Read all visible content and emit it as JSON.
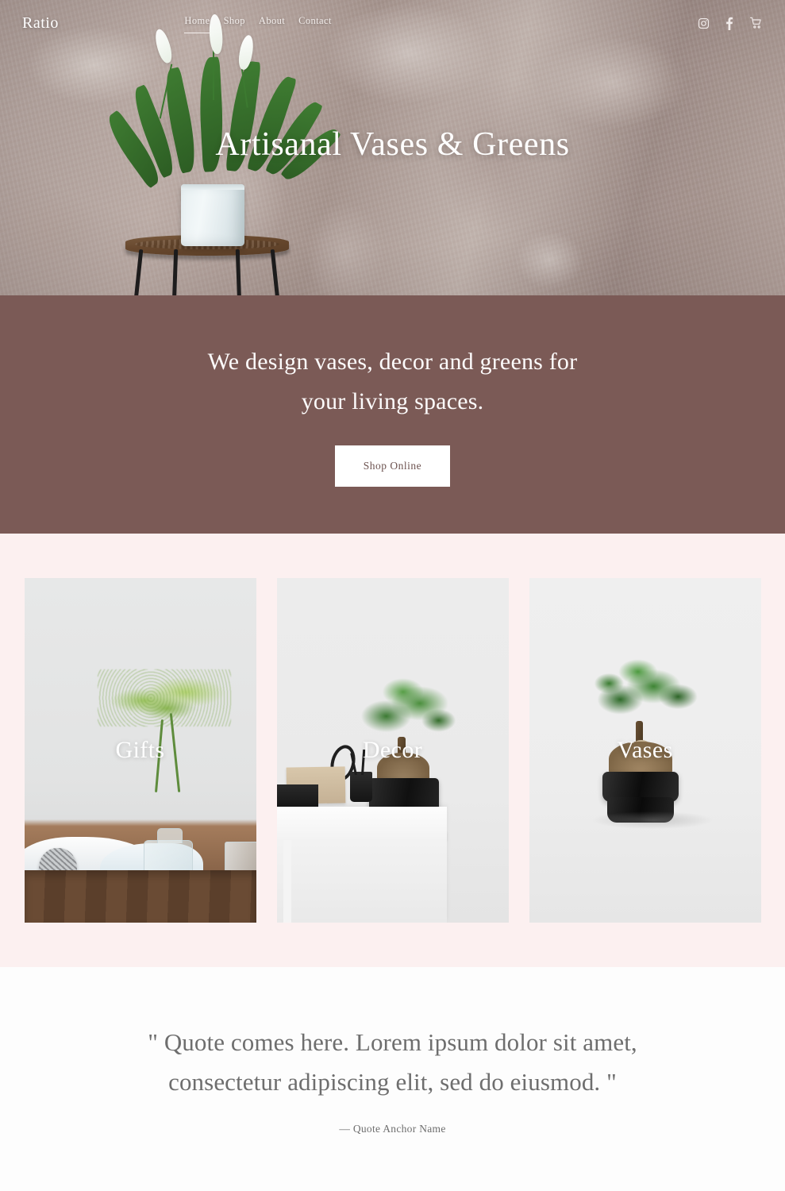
{
  "header": {
    "logo": "Ratio",
    "nav": [
      {
        "label": "Home",
        "active": true
      },
      {
        "label": "Shop",
        "active": false
      },
      {
        "label": "About",
        "active": false
      },
      {
        "label": "Contact",
        "active": false
      }
    ],
    "icons": [
      "instagram-icon",
      "facebook-icon",
      "cart-icon"
    ]
  },
  "hero": {
    "title": "Artisanal Vases & Greens",
    "image_description": "Peace lily plant in a white pot on a wooden stool against a weathered plaster wall"
  },
  "tagline": {
    "line1": "We design vases, decor and greens for",
    "line2": "your living spaces.",
    "button": "Shop Online"
  },
  "categories": [
    {
      "label": "Gifts",
      "image_description": "Green flowers in a glass jar with books, twine and burlap on a wooden table"
    },
    {
      "label": "Decor",
      "image_description": "Bonsai in a black planter on a white desk with stationery"
    },
    {
      "label": "Vases",
      "image_description": "Bonsai tree in a glossy black ceramic pot on a white surface"
    }
  ],
  "quote": {
    "line1": "\" Quote comes here. Lorem ipsum dolor sit amet,",
    "line2": "consectetur adipiscing elit, sed do eiusmod. \"",
    "anchor": "— Quote Anchor Name"
  },
  "colors": {
    "band_background": "#7b5a56",
    "cards_background": "#fcf0f0",
    "quote_background": "#fdfdfd",
    "button_background": "#ffffff",
    "button_text": "#6d5350",
    "quote_text": "#6e6e6e"
  }
}
